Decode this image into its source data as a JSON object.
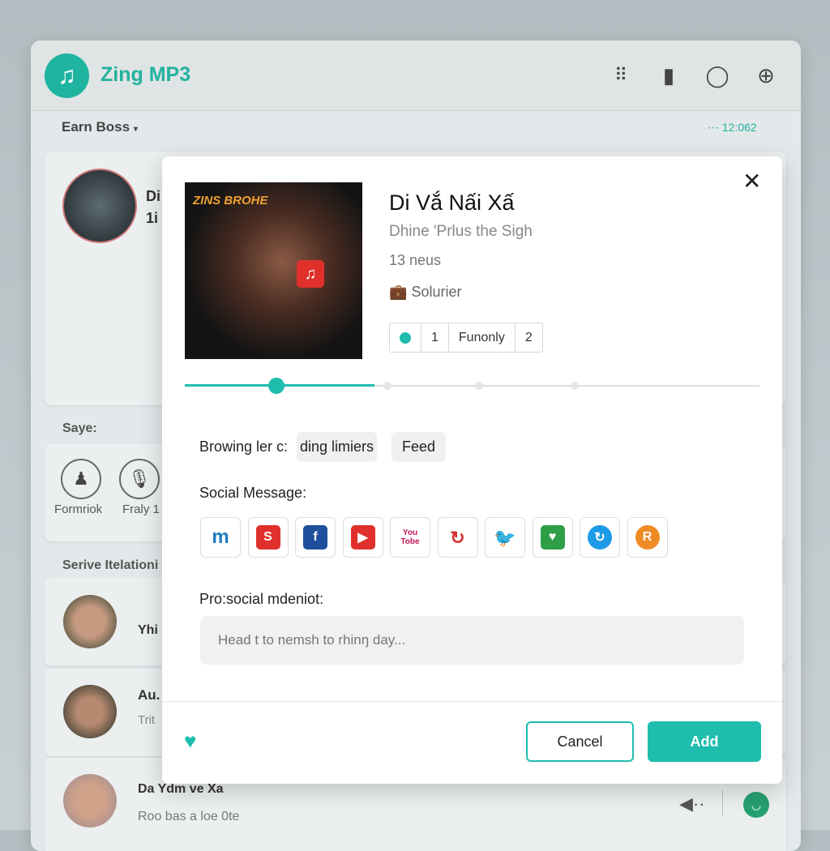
{
  "app": {
    "title": "Zing MP3",
    "header_icons": [
      "grid-icon",
      "equalizer-icon",
      "chat-icon",
      "add-circle-icon"
    ]
  },
  "subheader": {
    "title": "Earn Boss",
    "right_text": "12:062"
  },
  "background": {
    "profile": {
      "name": "Di",
      "sub": "1i"
    },
    "section_saye": "Saye:",
    "saye_items": [
      {
        "label": "Formriok",
        "icon": "person-icon"
      },
      {
        "label": "Fraly 1",
        "icon": "microphone-icon"
      }
    ],
    "section_relations": "Serive Itelationi",
    "list": [
      {
        "name": "Yhi",
        "sub": ""
      },
      {
        "name": "Au.",
        "sub": "Trit"
      },
      {
        "name": "Da Ydm ve Xa",
        "sub": "Roo bas a loe 0te"
      }
    ]
  },
  "modal": {
    "art_text": "ZINS BROHE",
    "title": "Di Vắ Nấi Xấ",
    "subtitle": "Dhine 'Prlus the Sigh",
    "count": "13 neus",
    "category": "Solurier",
    "segments": [
      "1",
      "Funonly",
      "2"
    ],
    "progress_percent": 16,
    "browsing_label": "Browing ler c:",
    "chips": [
      "ding limiers",
      "Feed"
    ],
    "social_label": "Social Message:",
    "social_icons": [
      {
        "name": "m-icon",
        "color": "#1f7fc4"
      },
      {
        "name": "app-red-icon",
        "color": "#e0302b"
      },
      {
        "name": "facebook-icon",
        "color": "#1e4f9c"
      },
      {
        "name": "youtube-icon",
        "color": "#e0302b"
      },
      {
        "name": "youtube-text-icon",
        "color": "#c2185b"
      },
      {
        "name": "arrows-icon",
        "color": "#d32f2f"
      },
      {
        "name": "twitter-icon",
        "color": "#5fb3ea"
      },
      {
        "name": "heart-chat-icon",
        "color": "#2e9e47"
      },
      {
        "name": "sync-icon",
        "color": "#1e9be6"
      },
      {
        "name": "r-icon",
        "color": "#f08a24"
      }
    ],
    "social_texts": [
      "m",
      "S",
      "f",
      "▶",
      "You\nTobe",
      "↻",
      "🐦",
      "♥",
      "↻",
      "R"
    ],
    "message_label": "Pro:social mdeniot:",
    "message_placeholder": "Head t to nemsh to rhinŋ day...",
    "cancel": "Cancel",
    "add": "Add"
  },
  "colors": {
    "accent": "#1ebdae"
  }
}
